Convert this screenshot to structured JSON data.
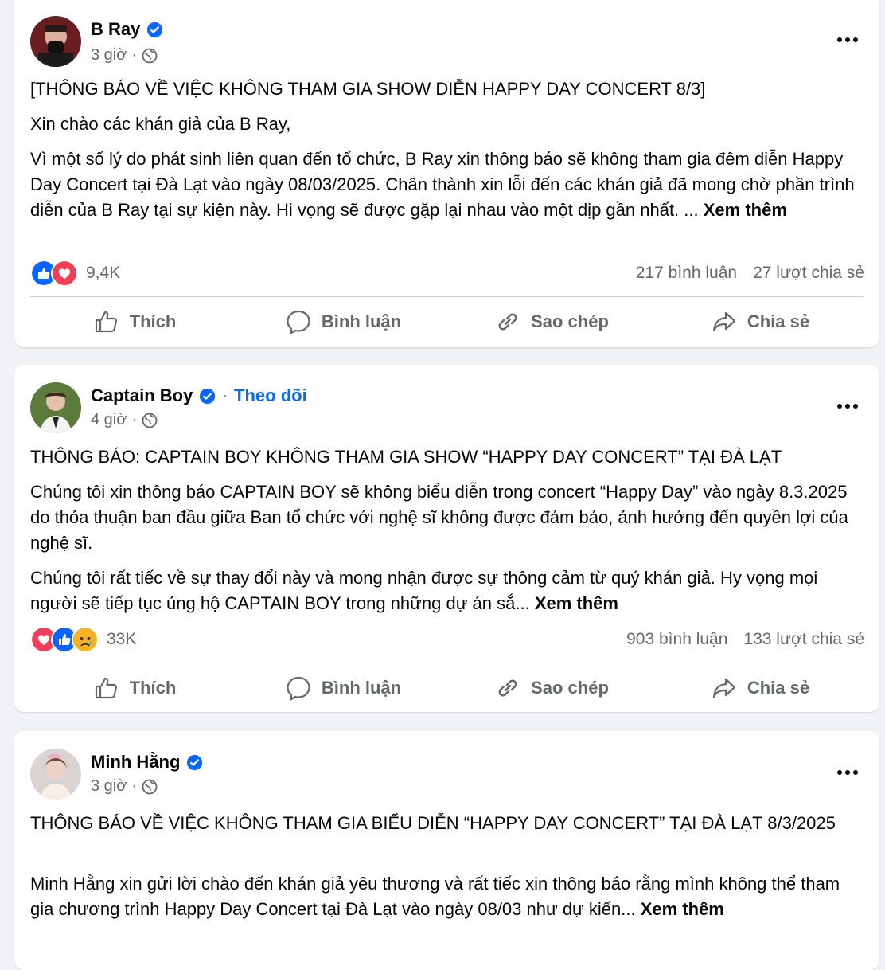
{
  "posts": [
    {
      "author": "B Ray",
      "verified": true,
      "follow_label": "",
      "time": "3 giờ",
      "title": "[THÔNG BÁO VỀ VIỆC KHÔNG THAM GIA SHOW DIỄN HAPPY DAY CONCERT 8/3]",
      "greeting": "Xin chào các khán giả của B Ray,",
      "body": "Vì một số lý do phát sinh liên quan đến tổ chức, B Ray xin thông báo sẽ không tham gia đêm diễn Happy Day Concert tại Đà Lạt vào ngày 08/03/2025. Chân thành xin lỗi đến các khán giả đã mong chờ phần trình diễn của B Ray tại sự kiện này. Hi vọng sẽ được gặp lại nhau vào một dịp gần nhất. ...",
      "see_more": "Xem thêm",
      "reactions": [
        "like",
        "love"
      ],
      "reaction_count": "9,4K",
      "comments": "217 bình luận",
      "shares": "27 lượt chia sẻ"
    },
    {
      "author": "Captain Boy",
      "verified": true,
      "follow_label": "Theo dõi",
      "time": "4 giờ",
      "title": "THÔNG BÁO: CAPTAIN BOY KHÔNG THAM GIA SHOW “HAPPY DAY CONCERT” TẠI ĐÀ LẠT",
      "body1": "Chúng tôi xin thông báo CAPTAIN BOY sẽ không biểu diễn trong concert “Happy Day” vào ngày 8.3.2025 do thỏa thuận ban đầu giữa Ban tổ chức với nghệ sĩ không được đảm bảo, ảnh hưởng đến quyền lợi của nghệ sĩ.",
      "body2": "Chúng tôi rất tiếc về sự thay đổi này và mong nhận được sự thông cảm từ quý khán giả. Hy vọng mọi người sẽ tiếp tục ủng hộ CAPTAIN BOY trong những dự án sắ...",
      "see_more": "Xem thêm",
      "reactions": [
        "love",
        "like",
        "sad"
      ],
      "reaction_count": "33K",
      "comments": "903 bình luận",
      "shares": "133 lượt chia sẻ"
    },
    {
      "author": "Minh Hằng",
      "verified": true,
      "follow_label": "",
      "time": "3 giờ",
      "title": "THÔNG BÁO VỀ VIỆC KHÔNG THAM GIA BIỂU DIỄN “HAPPY DAY CONCERT” TẠI ĐÀ LẠT 8/3/2025",
      "body": "Minh Hằng xin gửi lời chào đến khán giả yêu thương và rất tiếc xin thông báo rằng mình không thể tham gia chương trình Happy Day Concert tại Đà Lạt vào ngày 08/03 như dự kiến...",
      "see_more": "Xem thêm"
    }
  ],
  "actions": {
    "like": "Thích",
    "comment": "Bình luận",
    "copy": "Sao chép",
    "share": "Chia sẻ"
  },
  "icons": {
    "verified": "verified-badge-icon",
    "audience": "globe-icon",
    "more": "more-options-icon",
    "like": "thumbs-up-icon",
    "comment": "comment-bubble-icon",
    "copy": "link-icon",
    "share": "share-arrow-icon"
  },
  "colors": {
    "background": "#f0f2f5",
    "card": "#ffffff",
    "accent": "#0866ff",
    "secondary_text": "#65676b",
    "love": "#f33e58",
    "sad": "#f7b125"
  }
}
